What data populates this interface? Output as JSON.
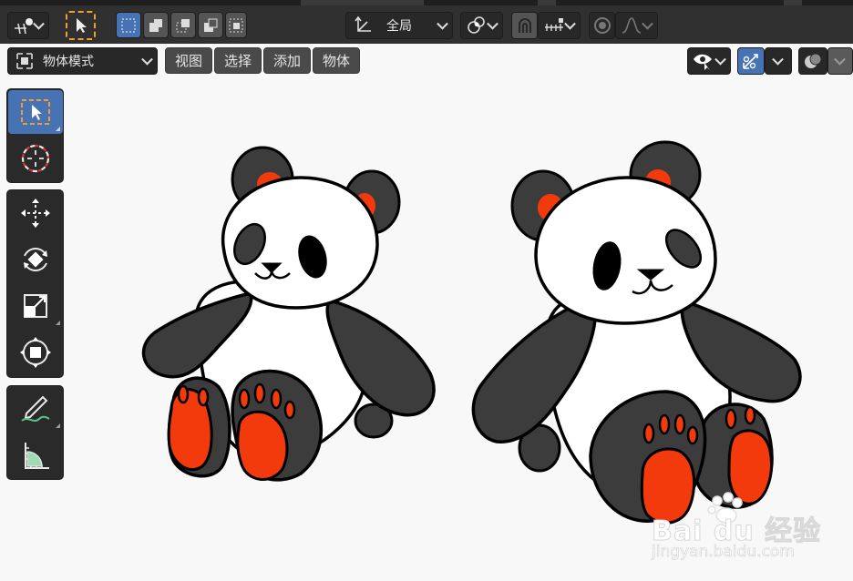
{
  "header": {
    "orientation_label": "全局",
    "mode_label": "物体模式",
    "menus": [
      "视图",
      "选择",
      "添加",
      "物体"
    ]
  },
  "icons": {
    "top": [
      "transform-pivot-icon",
      "select-cursor-icon",
      "select-box-mode-icon",
      "snap-icon",
      "proportional-edit-icon"
    ],
    "toolbar": [
      "select-box-icon",
      "cursor-icon",
      "move-icon",
      "rotate-icon",
      "scale-icon",
      "transform-icon",
      "annotate-icon",
      "measure-icon"
    ]
  },
  "colors": {
    "accent": "#4772b3",
    "topbar": "#303030",
    "panda_red": "#f23a0c",
    "panda_dark": "#3c3c3c"
  },
  "watermark": {
    "brand": "Bai du 经验",
    "url": "jingyan.baidu.com"
  }
}
